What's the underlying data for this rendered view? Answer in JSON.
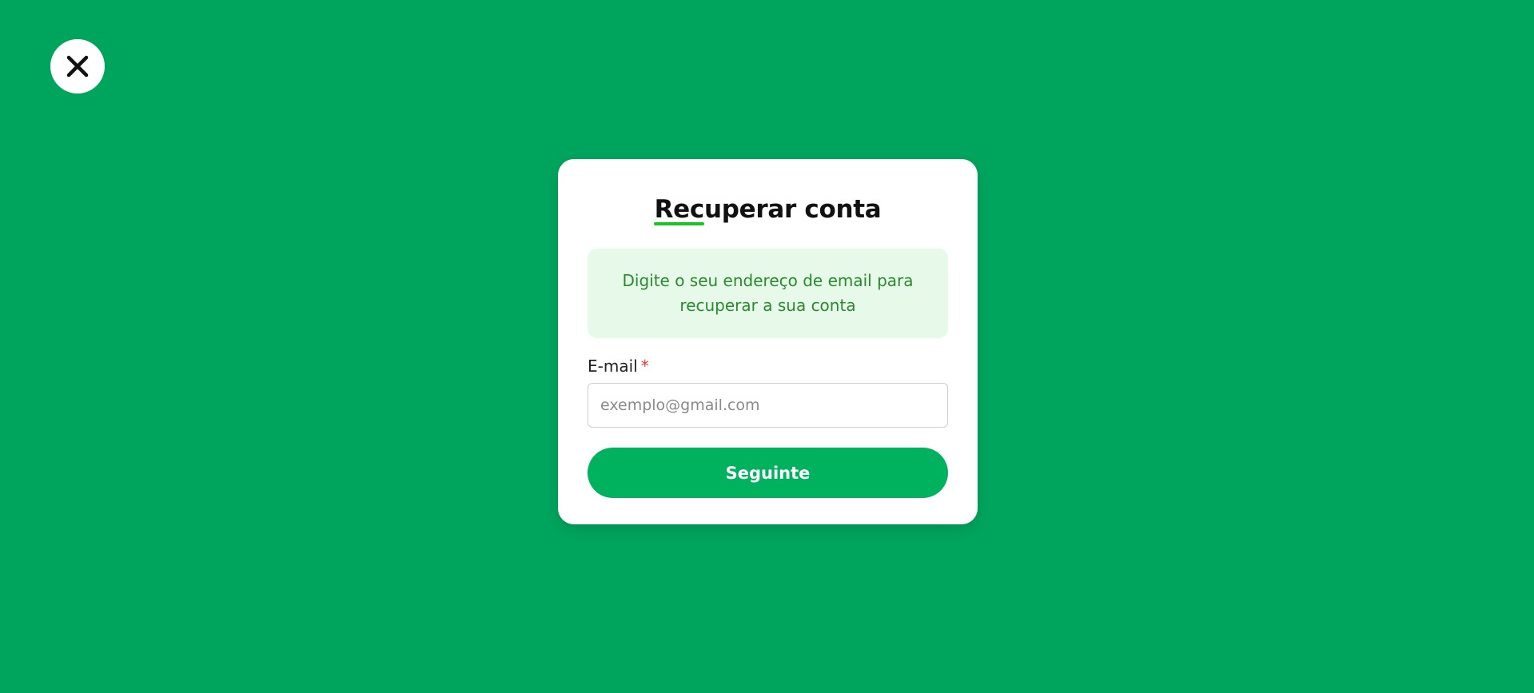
{
  "page": {
    "background_color": "#00a55d"
  },
  "close_button": {
    "icon": "close-icon"
  },
  "card": {
    "title": "Recuperar conta",
    "accent_color": "#19c521",
    "info_message": "Digite o seu endereço de email para recuperar a sua conta",
    "info_bg_color": "#e7faea",
    "info_text_color": "#2a8a2e"
  },
  "form": {
    "email_label": "E-mail",
    "required_marker": "*",
    "email_value": "",
    "email_placeholder": "exemplo@gmail.com",
    "submit_label": "Seguinte",
    "submit_color": "#00b25e"
  }
}
